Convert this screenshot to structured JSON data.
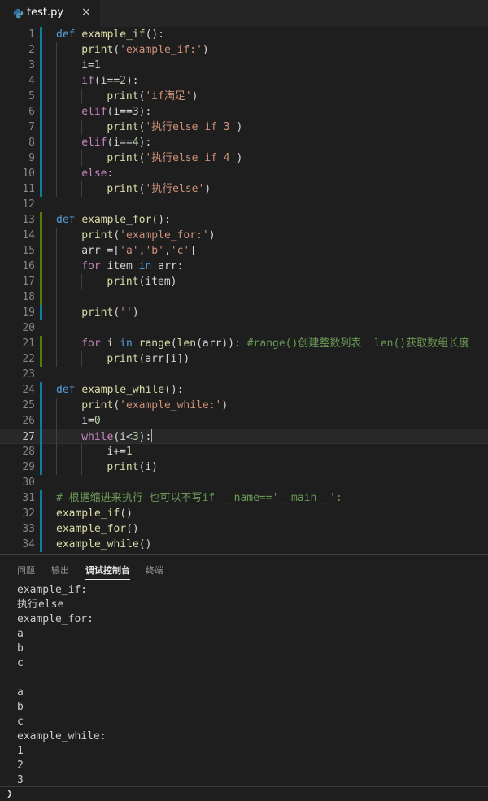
{
  "tab": {
    "filename": "test.py",
    "close": "×",
    "icon": "python-file-icon"
  },
  "editor": {
    "line_numbers": [
      "1",
      "2",
      "3",
      "4",
      "5",
      "6",
      "7",
      "8",
      "9",
      "10",
      "11",
      "12",
      "13",
      "14",
      "15",
      "16",
      "17",
      "18",
      "19",
      "20",
      "21",
      "22",
      "23",
      "24",
      "25",
      "26",
      "27",
      "28",
      "29",
      "30",
      "31",
      "32",
      "33",
      "34"
    ],
    "active_line": "27",
    "lines": [
      {
        "indent": 0,
        "tokens": [
          [
            "kw",
            "def"
          ],
          [
            "pl",
            " "
          ],
          [
            "fn",
            "example_if"
          ],
          [
            "pl",
            "():"
          ]
        ]
      },
      {
        "indent": 1,
        "tokens": [
          [
            "fn",
            "print"
          ],
          [
            "pl",
            "("
          ],
          [
            "str",
            "'example_if:'"
          ],
          [
            "pl",
            ")"
          ]
        ]
      },
      {
        "indent": 1,
        "tokens": [
          [
            "pl",
            "i="
          ],
          [
            "num",
            "1"
          ]
        ]
      },
      {
        "indent": 1,
        "tokens": [
          [
            "ctl",
            "if"
          ],
          [
            "pl",
            "(i=="
          ],
          [
            "num",
            "2"
          ],
          [
            "pl",
            "):"
          ]
        ]
      },
      {
        "indent": 2,
        "tokens": [
          [
            "fn",
            "print"
          ],
          [
            "pl",
            "("
          ],
          [
            "str",
            "'if满足'"
          ],
          [
            "pl",
            ")"
          ]
        ]
      },
      {
        "indent": 1,
        "tokens": [
          [
            "ctl",
            "elif"
          ],
          [
            "pl",
            "(i=="
          ],
          [
            "num",
            "3"
          ],
          [
            "pl",
            "):"
          ]
        ]
      },
      {
        "indent": 2,
        "tokens": [
          [
            "fn",
            "print"
          ],
          [
            "pl",
            "("
          ],
          [
            "str",
            "'执行else if 3'"
          ],
          [
            "pl",
            ")"
          ]
        ]
      },
      {
        "indent": 1,
        "tokens": [
          [
            "ctl",
            "elif"
          ],
          [
            "pl",
            "(i=="
          ],
          [
            "num",
            "4"
          ],
          [
            "pl",
            "):"
          ]
        ]
      },
      {
        "indent": 2,
        "tokens": [
          [
            "fn",
            "print"
          ],
          [
            "pl",
            "("
          ],
          [
            "str",
            "'执行else if 4'"
          ],
          [
            "pl",
            ")"
          ]
        ]
      },
      {
        "indent": 1,
        "tokens": [
          [
            "ctl",
            "else"
          ],
          [
            "pl",
            ":"
          ]
        ]
      },
      {
        "indent": 2,
        "tokens": [
          [
            "fn",
            "print"
          ],
          [
            "pl",
            "("
          ],
          [
            "str",
            "'执行else'"
          ],
          [
            "pl",
            ")"
          ]
        ]
      },
      {
        "indent": 0,
        "tokens": []
      },
      {
        "indent": 0,
        "tokens": [
          [
            "kw",
            "def"
          ],
          [
            "pl",
            " "
          ],
          [
            "fn",
            "example_for"
          ],
          [
            "pl",
            "():"
          ]
        ]
      },
      {
        "indent": 1,
        "tokens": [
          [
            "fn",
            "print"
          ],
          [
            "pl",
            "("
          ],
          [
            "str",
            "'example_for:'"
          ],
          [
            "pl",
            ")"
          ]
        ]
      },
      {
        "indent": 1,
        "tokens": [
          [
            "pl",
            "arr =["
          ],
          [
            "str",
            "'a'"
          ],
          [
            "pl",
            ","
          ],
          [
            "str",
            "'b'"
          ],
          [
            "pl",
            ","
          ],
          [
            "str",
            "'c'"
          ],
          [
            "pl",
            "]"
          ]
        ]
      },
      {
        "indent": 1,
        "tokens": [
          [
            "ctl",
            "for"
          ],
          [
            "pl",
            " item "
          ],
          [
            "kw",
            "in"
          ],
          [
            "pl",
            " arr:"
          ]
        ]
      },
      {
        "indent": 2,
        "tokens": [
          [
            "fn",
            "print"
          ],
          [
            "pl",
            "(item)"
          ]
        ]
      },
      {
        "indent": 1,
        "tokens": []
      },
      {
        "indent": 1,
        "tokens": [
          [
            "fn",
            "print"
          ],
          [
            "pl",
            "("
          ],
          [
            "str",
            "''"
          ],
          [
            "pl",
            ")"
          ]
        ]
      },
      {
        "indent": 1,
        "tokens": []
      },
      {
        "indent": 1,
        "tokens": [
          [
            "ctl",
            "for"
          ],
          [
            "pl",
            " i "
          ],
          [
            "kw",
            "in"
          ],
          [
            "pl",
            " "
          ],
          [
            "fn",
            "range"
          ],
          [
            "pl",
            "("
          ],
          [
            "fn",
            "len"
          ],
          [
            "pl",
            "(arr)): "
          ],
          [
            "cm",
            "#range()创建整数列表  len()获取数组长度"
          ]
        ]
      },
      {
        "indent": 2,
        "tokens": [
          [
            "fn",
            "print"
          ],
          [
            "pl",
            "(arr[i])"
          ]
        ]
      },
      {
        "indent": 0,
        "tokens": []
      },
      {
        "indent": 0,
        "tokens": [
          [
            "kw",
            "def"
          ],
          [
            "pl",
            " "
          ],
          [
            "fn",
            "example_while"
          ],
          [
            "pl",
            "():"
          ]
        ]
      },
      {
        "indent": 1,
        "tokens": [
          [
            "fn",
            "print"
          ],
          [
            "pl",
            "("
          ],
          [
            "str",
            "'example_while:'"
          ],
          [
            "pl",
            ")"
          ]
        ]
      },
      {
        "indent": 1,
        "tokens": [
          [
            "pl",
            "i="
          ],
          [
            "num",
            "0"
          ]
        ]
      },
      {
        "indent": 1,
        "tokens": [
          [
            "ctl",
            "while"
          ],
          [
            "pl",
            "(i<"
          ],
          [
            "num",
            "3"
          ],
          [
            "pl",
            "):"
          ]
        ]
      },
      {
        "indent": 2,
        "tokens": [
          [
            "pl",
            "i+="
          ],
          [
            "num",
            "1"
          ]
        ]
      },
      {
        "indent": 2,
        "tokens": [
          [
            "fn",
            "print"
          ],
          [
            "pl",
            "(i)"
          ]
        ]
      },
      {
        "indent": 0,
        "tokens": []
      },
      {
        "indent": 0,
        "tokens": [
          [
            "cm",
            "# 根据缩进来执行 也可以不写if __name=='__main__':"
          ]
        ]
      },
      {
        "indent": 0,
        "tokens": [
          [
            "fn",
            "example_if"
          ],
          [
            "pl",
            "()"
          ]
        ]
      },
      {
        "indent": 0,
        "tokens": [
          [
            "fn",
            "example_for"
          ],
          [
            "pl",
            "()"
          ]
        ]
      },
      {
        "indent": 0,
        "tokens": [
          [
            "fn",
            "example_while"
          ],
          [
            "pl",
            "()"
          ]
        ]
      }
    ],
    "gutter_marks": [
      "blue",
      "blue",
      "blue",
      "blue",
      "blue",
      "blue",
      "blue",
      "blue",
      "blue",
      "blue",
      "blue",
      "",
      "green",
      "green",
      "green",
      "green",
      "green",
      "green",
      "blue",
      "",
      "green",
      "green",
      "",
      "blue",
      "blue",
      "blue",
      "blue",
      "blue",
      "blue",
      "",
      "blue",
      "blue",
      "blue",
      "blue"
    ]
  },
  "panel": {
    "tabs": [
      "问题",
      "输出",
      "调试控制台",
      "终端"
    ],
    "active_tab": "调试控制台",
    "output": [
      "example_if:",
      "执行else",
      "example_for:",
      "a",
      "b",
      "c",
      "",
      "a",
      "b",
      "c",
      "example_while:",
      "1",
      "2",
      "3"
    ],
    "prompt": "❯"
  },
  "colors": {
    "editor_bg": "#1e1e1e",
    "keyword": "#569cd6",
    "control": "#c586c0",
    "function": "#dcdcaa",
    "string": "#ce9178",
    "number": "#b5cea8",
    "comment": "#6a9955",
    "gutter_modified": "#0c7d9d",
    "gutter_added": "#587c0c"
  }
}
